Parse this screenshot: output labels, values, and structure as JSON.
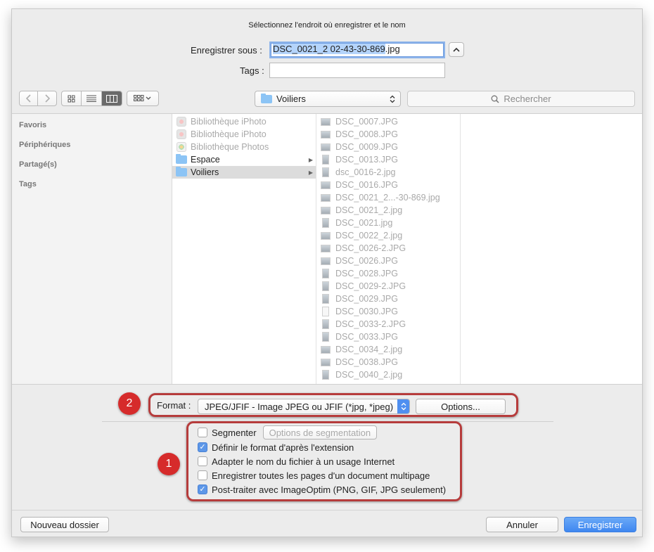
{
  "header": {
    "message": "Sélectionnez l'endroit où enregistrer et le nom",
    "save_as_label": "Enregistrer sous :",
    "save_as_value": "DSC_0021_2 02-43-30-869.jpg",
    "save_as_selected": "DSC_0021_2 02-43-30-869",
    "save_as_ext": ".jpg",
    "tags_label": "Tags :",
    "tags_value": ""
  },
  "toolbar": {
    "location": "Voiliers",
    "search_placeholder": "Rechercher"
  },
  "sidebar": {
    "sections": [
      "Favoris",
      "Périphériques",
      "Partagé(s)",
      "Tags"
    ]
  },
  "column1": {
    "items": [
      {
        "label": "Bibliothèque iPhoto",
        "icon": "iphoto-library-icon",
        "enabled": false
      },
      {
        "label": "Bibliothèque iPhoto",
        "icon": "iphoto-library-icon",
        "enabled": false
      },
      {
        "label": "Bibliothèque Photos",
        "icon": "photos-library-icon",
        "enabled": false
      },
      {
        "label": "Espace",
        "icon": "folder-icon",
        "enabled": true
      },
      {
        "label": "Voiliers",
        "icon": "folder-icon",
        "enabled": true,
        "selected": true
      }
    ]
  },
  "column2": {
    "items": [
      "DSC_0007.JPG",
      "DSC_0008.JPG",
      "DSC_0009.JPG",
      "DSC_0013.JPG",
      "dsc_0016-2.jpg",
      "DSC_0016.JPG",
      "DSC_0021_2...-30-869.jpg",
      "DSC_0021_2.jpg",
      "DSC_0021.jpg",
      "DSC_0022_2.jpg",
      "DSC_0026-2.JPG",
      "DSC_0026.JPG",
      "DSC_0028.JPG",
      "DSC_0029-2.JPG",
      "DSC_0029.JPG",
      "DSC_0030.JPG",
      "DSC_0033-2.JPG",
      "DSC_0033.JPG",
      "DSC_0034_2.jpg",
      "DSC_0038.JPG",
      "DSC_0040_2.jpg"
    ]
  },
  "format": {
    "label": "Format :",
    "value": "JPEG/JFIF - Image JPEG ou JFIF (*jpg, *jpeg)",
    "options_button": "Options...",
    "badge": "2"
  },
  "options": {
    "badge": "1",
    "segment_label": "Segmenter",
    "segment_options_button": "Options de segmentation",
    "items": [
      {
        "label": "Définir le format d'après l'extension",
        "checked": true
      },
      {
        "label": "Adapter le nom du fichier à un usage Internet",
        "checked": false
      },
      {
        "label": "Enregistrer toutes les pages d'un document multipage",
        "checked": false
      },
      {
        "label": "Post-traiter avec ImageOptim (PNG, GIF, JPG seulement)",
        "checked": true
      }
    ]
  },
  "footer": {
    "new_folder": "Nouveau dossier",
    "cancel": "Annuler",
    "save": "Enregistrer"
  },
  "colors": {
    "accent": "#3f87f0",
    "annotation_red": "#d62b2b"
  }
}
